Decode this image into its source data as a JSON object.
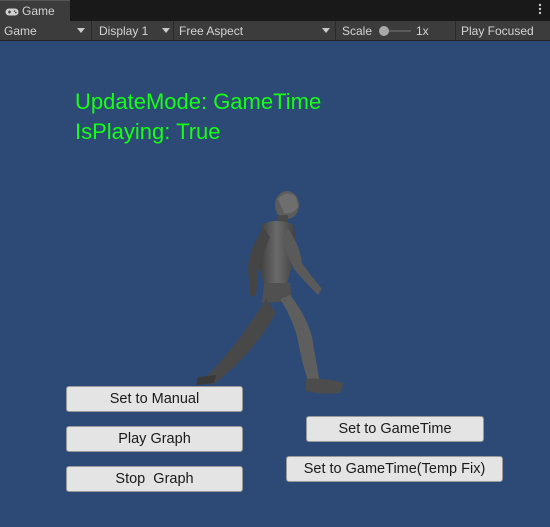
{
  "tab": {
    "label": "Game",
    "icon": "gamepad-icon"
  },
  "toolbar": {
    "view_mode": "Game",
    "display": "Display 1",
    "aspect": "Free Aspect",
    "scale_label": "Scale",
    "scale_value": "1x",
    "play_mode": "Play Focused",
    "menu_icon": "kebab-menu-icon"
  },
  "overlay": {
    "update_mode": "UpdateMode: GameTime",
    "is_playing": "IsPlaying: True"
  },
  "buttons": {
    "set_manual": "Set to Manual",
    "play_graph": "Play Graph",
    "stop_graph": "Stop  Graph",
    "set_gametime": "Set to GameTime",
    "set_gametime_fix": "Set to GameTime(Temp Fix)"
  },
  "colors": {
    "background": "#2d4a77",
    "overlay_text": "#13ff13",
    "button_bg": "#e4e4e4",
    "toolbar_bg": "#3c3c3c"
  },
  "scene": {
    "character": "walking-mannequin"
  }
}
